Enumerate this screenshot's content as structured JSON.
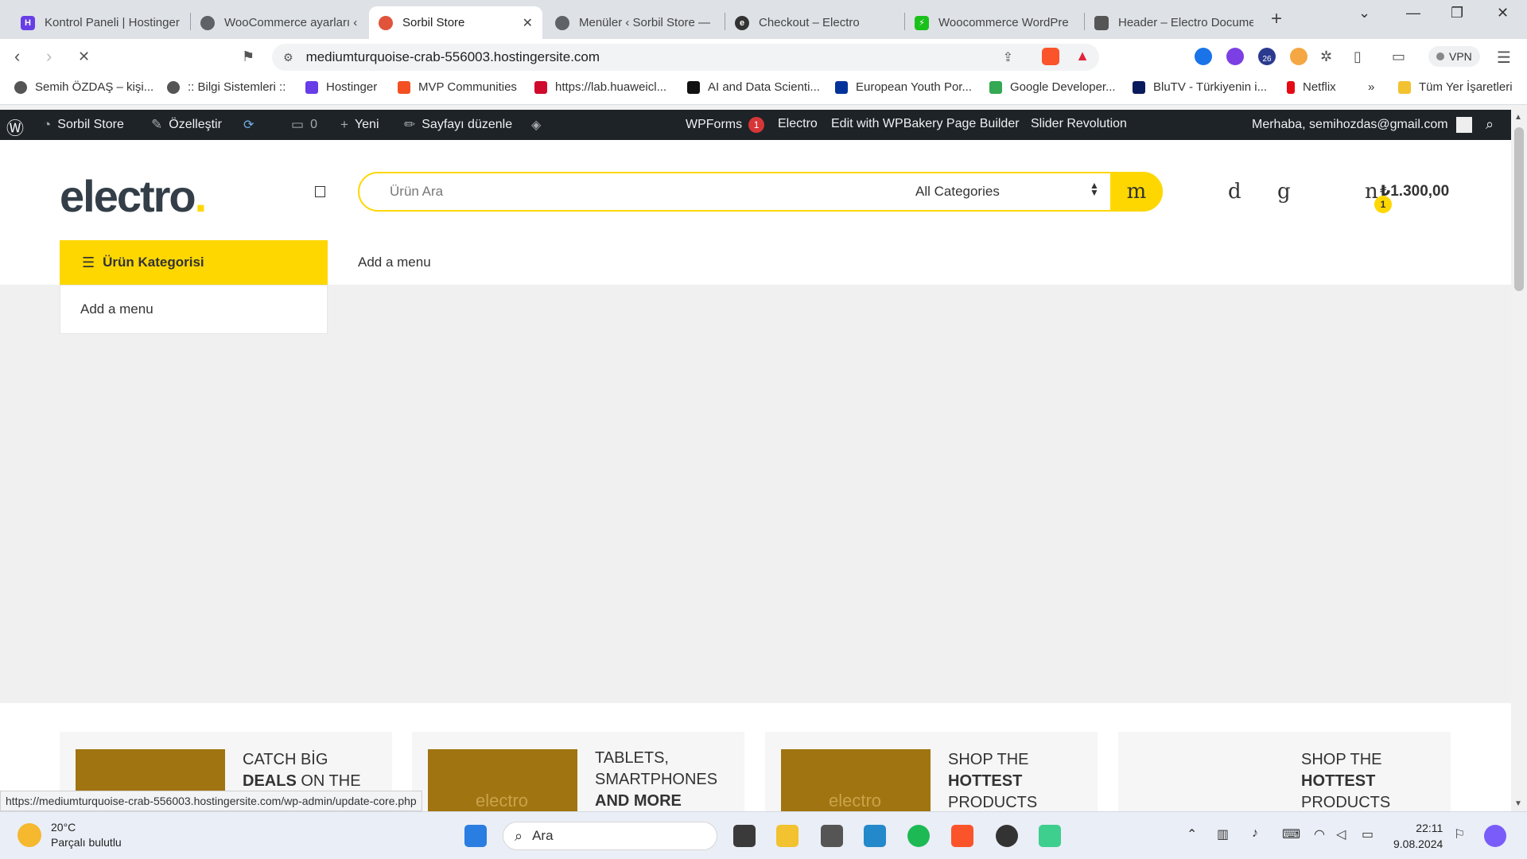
{
  "browser": {
    "tabs": [
      {
        "title": "Kontrol Paneli | Hostinger",
        "color": "#673de6"
      },
      {
        "title": "WooCommerce ayarları ‹",
        "color": "#5f6368"
      },
      {
        "title": "Sorbil Store",
        "color": "#e0543b",
        "active": true
      },
      {
        "title": "Menüler ‹ Sorbil Store —",
        "color": "#5f6368"
      },
      {
        "title": "Checkout – Electro",
        "color": "#333333"
      },
      {
        "title": "Woocommerce WordPre",
        "color": "#1bc11b"
      },
      {
        "title": "Header – Electro Docume",
        "color": "#555555"
      }
    ],
    "new_tab": "+",
    "url": "mediumturquoise-crab-556003.hostingersite.com",
    "vpn_label": "VPN",
    "ext_badge": "26",
    "bookmarks": [
      "Semih ÖZDAŞ – kişi...",
      ":: Bilgi Sistemleri ::",
      "Hostinger",
      "MVP Communities",
      "https://lab.huaweicl...",
      "AI and Data Scienti...",
      "European Youth Por...",
      "Google Developer...",
      "BluTV - Türkiyenin i...",
      "Netflix",
      "»",
      "Tüm Yer İşaretleri"
    ],
    "status_url": "https://mediumturquoise-crab-556003.hostingersite.com/wp-admin/update-core.php"
  },
  "adminbar": {
    "site": "Sorbil Store",
    "customize": "Özelleştir",
    "comments": "0",
    "new": "Yeni",
    "edit_page": "Sayfayı düzenle",
    "wpforms": "WPForms",
    "wpforms_badge": "1",
    "electro": "Electro",
    "wpbakery": "Edit with WPBakery Page Builder",
    "slider": "Slider Revolution",
    "greeting": "Merhaba, semihozdas@gmail.com"
  },
  "site": {
    "logo_text": "electro",
    "logo_dot": ".",
    "search_placeholder": "Ürün Ara",
    "category_select": "All Categories",
    "search_glyph": "m",
    "icon_compare": "d",
    "icon_wishlist": "g",
    "icon_cart": "n",
    "cart_count": "1",
    "cart_total": "₺1.300,00",
    "category_button": "Ürün Kategorisi",
    "add_menu_top": "Add a menu",
    "add_menu_panel": "Add a menu",
    "brand_color": "#fed700",
    "cards": [
      {
        "line1": "CATCH BİG",
        "line2_bold": "DEALS",
        "line2_rest": " ON THE",
        "image_text": ""
      },
      {
        "line1": "TABLETS,",
        "line2_bold": "",
        "line2_rest": "SMARTPHONES",
        "line3_bold": "AND MORE",
        "image_text": "electro"
      },
      {
        "line1": "SHOP THE",
        "line2_bold": "HOTTEST",
        "line2_rest": "",
        "line3": "PRODUCTS",
        "image_text": "electro"
      },
      {
        "line1": "SHOP THE",
        "line2_bold": "HOTTEST",
        "line2_rest": "",
        "line3": "PRODUCTS",
        "image_text": ""
      }
    ]
  },
  "taskbar": {
    "temp": "20°C",
    "weather": "Parçalı bulutlu",
    "search": "Ara",
    "time": "22:11",
    "date": "9.08.2024"
  }
}
